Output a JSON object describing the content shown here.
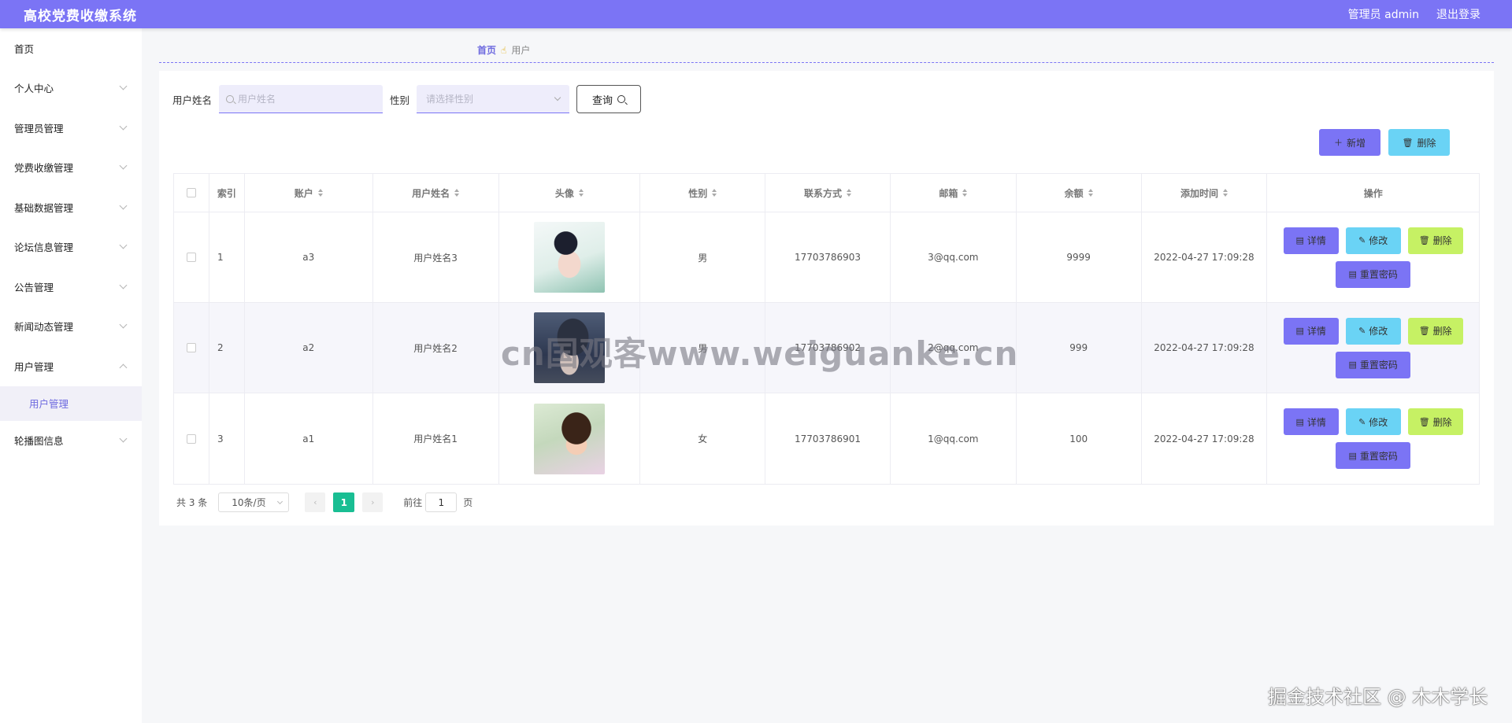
{
  "header": {
    "title": "高校党费收缴系统",
    "admin_label": "管理员 admin",
    "logout_label": "退出登录"
  },
  "sidebar": {
    "items": [
      {
        "label": "首页",
        "chevron": false
      },
      {
        "label": "个人中心",
        "chevron": true
      },
      {
        "label": "管理员管理",
        "chevron": true
      },
      {
        "label": "党费收缴管理",
        "chevron": true
      },
      {
        "label": "基础数据管理",
        "chevron": true
      },
      {
        "label": "论坛信息管理",
        "chevron": true
      },
      {
        "label": "公告管理",
        "chevron": true
      },
      {
        "label": "新闻动态管理",
        "chevron": true
      },
      {
        "label": "用户管理",
        "chevron": true,
        "expanded": true
      },
      {
        "label": "轮播图信息",
        "chevron": true
      }
    ],
    "sub_items": [
      {
        "label": "用户管理",
        "active": true
      }
    ]
  },
  "breadcrumb": {
    "home": "首页",
    "separator_icon": "hand-pointer-icon",
    "current": "用户"
  },
  "search": {
    "name_label": "用户姓名",
    "name_placeholder": "用户姓名",
    "gender_label": "性别",
    "gender_placeholder": "请选择性别",
    "query_label": "查询"
  },
  "toolbar": {
    "add_label": "新增",
    "delete_label": "删除"
  },
  "table": {
    "headers": {
      "index": "索引",
      "account": "账户",
      "name": "用户姓名",
      "avatar": "头像",
      "gender": "性别",
      "phone": "联系方式",
      "email": "邮箱",
      "balance": "余额",
      "created": "添加时间",
      "actions": "操作"
    },
    "rows": [
      {
        "index": "1",
        "account": "a3",
        "name": "用户姓名3",
        "gender": "男",
        "phone": "17703786903",
        "email": "3@qq.com",
        "balance": "9999",
        "created": "2022-04-27 17:09:28"
      },
      {
        "index": "2",
        "account": "a2",
        "name": "用户姓名2",
        "gender": "男",
        "phone": "17703786902",
        "email": "2@qq.com",
        "balance": "999",
        "created": "2022-04-27 17:09:28"
      },
      {
        "index": "3",
        "account": "a1",
        "name": "用户姓名1",
        "gender": "女",
        "phone": "17703786901",
        "email": "1@qq.com",
        "balance": "100",
        "created": "2022-04-27 17:09:28"
      }
    ],
    "row_actions": {
      "detail": "详情",
      "edit": "修改",
      "delete": "删除",
      "reset_password": "重置密码"
    }
  },
  "pagination": {
    "total": "共 3 条",
    "page_size": "10条/页",
    "current_page": "1",
    "goto_label": "前往",
    "goto_value": "1",
    "page_unit": "页"
  },
  "watermarks": {
    "center": "cn国观客www.weiguanke.cn",
    "bottom": "掘金技术社区 @ 木木学长"
  },
  "colors": {
    "header": "#7b74f5",
    "accent": "#7b74f5",
    "info": "#6ad3f5",
    "danger": "#c6f164",
    "pager_active": "#19be93"
  }
}
